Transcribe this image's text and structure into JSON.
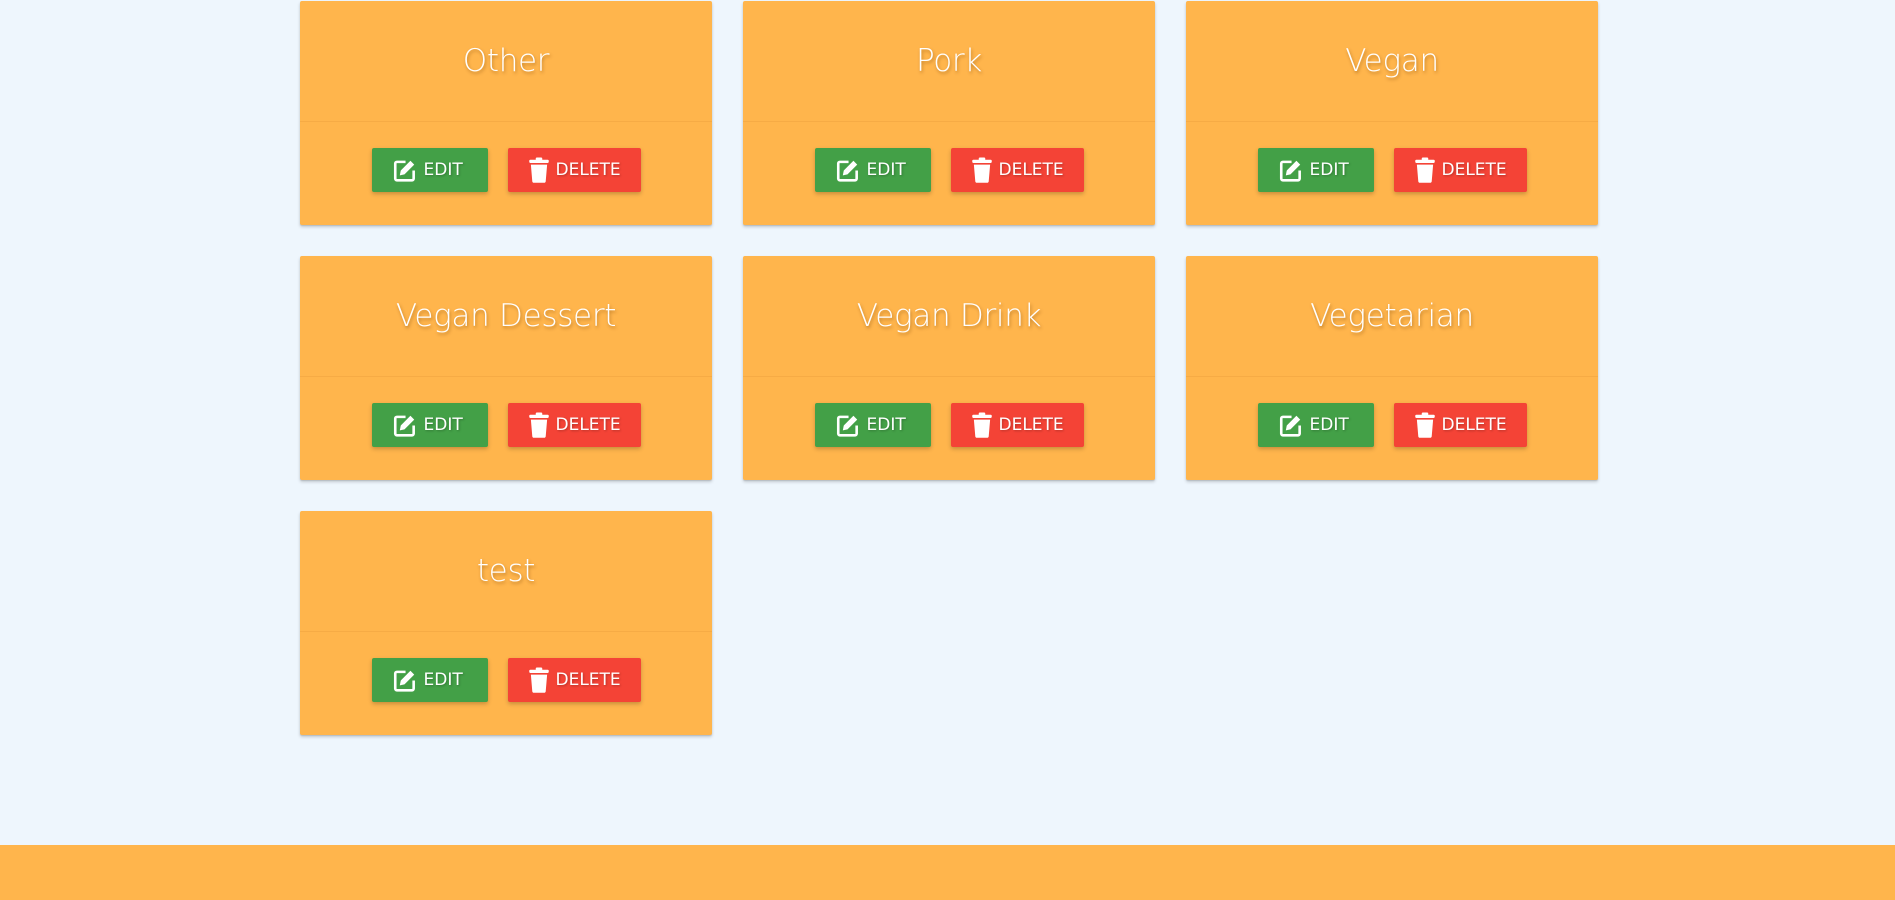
{
  "categories": [
    {
      "name": "Other"
    },
    {
      "name": "Pork"
    },
    {
      "name": "Vegan"
    },
    {
      "name": "Vegan Dessert"
    },
    {
      "name": "Vegan Drink"
    },
    {
      "name": "Vegetarian"
    },
    {
      "name": "test"
    }
  ],
  "actions": {
    "edit_label": "Edit",
    "delete_label": "Delete",
    "edit_icon": "edit-icon",
    "delete_icon": "trash-icon"
  },
  "colors": {
    "card": "#ffb54c",
    "edit": "#43a047",
    "delete": "#f44336",
    "background": "#eef6fd"
  }
}
